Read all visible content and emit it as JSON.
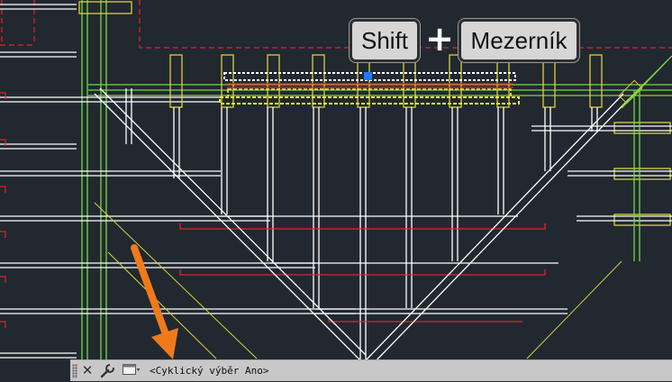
{
  "keys": {
    "shift_label": "Shift",
    "plus_label": "+",
    "space_label": "Mezerník"
  },
  "command_line": {
    "text": "<Cyklický výběr Ano>"
  },
  "icons": [
    "close-icon",
    "wrench-icon",
    "command-prompt-icon",
    "arrow-annotation-icon"
  ],
  "colors": {
    "background": "#212830",
    "white_lines": "#ffffff",
    "red_lines": "#e8202a",
    "green_lines": "#6fdc3c",
    "yellow_lines": "#d8d23a",
    "selection_grip": "#1e7bff",
    "arrow": "#f07a1a",
    "command_bar": "#c8c8c8"
  }
}
